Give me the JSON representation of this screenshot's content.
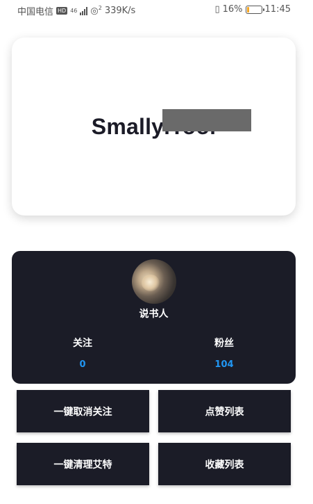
{
  "statusbar": {
    "carrier": "中国电信",
    "hd": "HD",
    "network": "46",
    "hotspot": "2",
    "speed": "339K/s",
    "battery": "16%",
    "battery_level": 0.16,
    "time": "11:45"
  },
  "banner": {
    "title": "SmallyiTool"
  },
  "profile": {
    "username": "说书人",
    "following_label": "关注",
    "following_count": "0",
    "fans_label": "粉丝",
    "fans_count": "104"
  },
  "actions": {
    "unfollow_all": "一键取消关注",
    "like_list": "点赞列表",
    "clean_mentions": "一键清理艾特",
    "favorites_list": "收藏列表"
  },
  "colors": {
    "card_dark": "#1b1c27",
    "count_blue": "#2196f3",
    "battery_orange": "#f5a623"
  }
}
